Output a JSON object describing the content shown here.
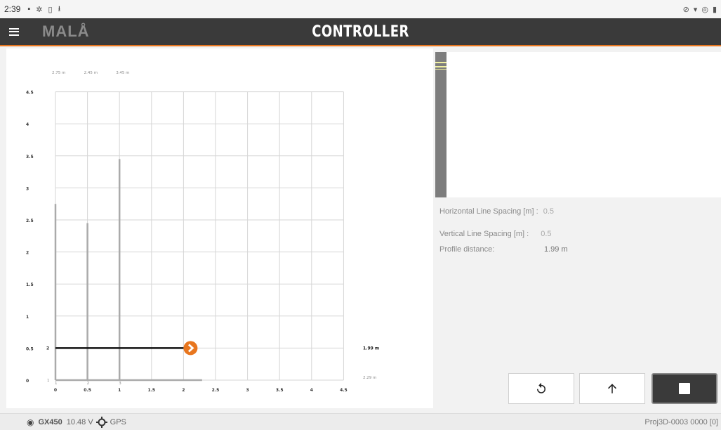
{
  "status_bar": {
    "time": "2:39",
    "left_icons": [
      "image-icon",
      "settings-icon",
      "sim-icon",
      "download-icon"
    ],
    "right_icons": [
      "mute-icon",
      "wifi-icon",
      "signal-icon",
      "battery-icon"
    ]
  },
  "app_bar": {
    "logo": "MALÅ",
    "title": "CONTROLLER"
  },
  "grid": {
    "top_labels": [
      "2.75 m",
      "2.45 m",
      "3.45 m"
    ],
    "y_ticks": [
      "4.5",
      "4",
      "3.5",
      "3",
      "2.5",
      "2",
      "1.5",
      "1",
      "0.5",
      "0"
    ],
    "x_ticks": [
      "0",
      "0.5",
      "1",
      "1.5",
      "2",
      "2.5",
      "3",
      "3.5",
      "4",
      "4.5"
    ],
    "line_numbers_bottom": [
      "1",
      "2",
      "3"
    ],
    "line_number_left": "2",
    "line_number_bottom_left": "1",
    "current_distance_label": "1.99 m",
    "end_label": "2.29 m",
    "current_profile": {
      "y": 0.5,
      "x_end": 2.0
    },
    "vertical_profiles": [
      {
        "x": 0,
        "y_top": 2.75
      },
      {
        "x": 0.5,
        "y_top": 2.45
      },
      {
        "x": 1.0,
        "y_top": 3.45
      }
    ],
    "bottom_profile": {
      "y": 0,
      "x_end": 2.29
    }
  },
  "info": {
    "h_spacing_label": "Horizontal Line Spacing [m] :",
    "h_spacing_value": "0.5",
    "v_spacing_label": "Vertical Line Spacing [m] :",
    "v_spacing_value": "0.5",
    "profile_label": "Profile distance:",
    "profile_value": "1.99 m"
  },
  "buttons": {
    "undo": "undo-icon",
    "up": "arrow-up-icon",
    "stop": "stop-icon"
  },
  "bottom_bar": {
    "device": "GX450",
    "voltage": "10.48 V",
    "gps": "GPS",
    "project": "Proj3D-0003  0000 [0]"
  },
  "colors": {
    "accent": "#e8761e",
    "appbar": "#3a3a3a"
  }
}
